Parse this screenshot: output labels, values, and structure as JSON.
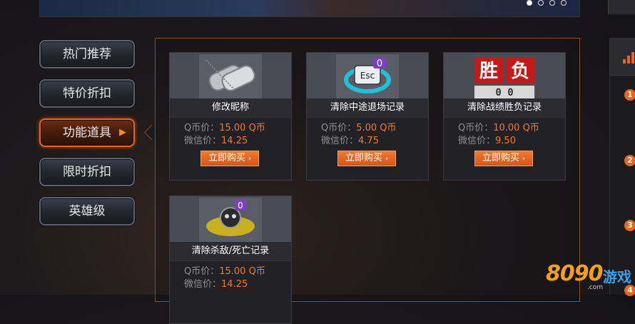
{
  "banner": {
    "dots": 4,
    "active_dot": 1
  },
  "nav": {
    "items": [
      {
        "label": "热门推荐",
        "active": false
      },
      {
        "label": "特价折扣",
        "active": false
      },
      {
        "label": "功能道具",
        "active": true
      },
      {
        "label": "限时折扣",
        "active": false
      },
      {
        "label": "英雄级",
        "active": false
      }
    ]
  },
  "price_labels": {
    "qb": "Q币价：",
    "wx": "微信价："
  },
  "buy_label": "立即购买",
  "products": [
    {
      "name": "修改昵称",
      "qb_price": "15.00 Q币",
      "wx_price": "14.25",
      "icon": "dog-tags-icon"
    },
    {
      "name": "清除中途退场记录",
      "qb_price": "5.00 Q币",
      "wx_price": "4.75",
      "icon": "esc-key-icon",
      "icon_text": "Esc",
      "icon_badge": "0"
    },
    {
      "name": "清除战绩胜负记录",
      "qb_price": "10.00 Q币",
      "wx_price": "9.50",
      "icon": "win-loss-board-icon",
      "icon_text_left": "胜",
      "icon_text_right": "负",
      "icon_score": "0 0"
    },
    {
      "name": "清除杀敌/死亡记录",
      "qb_price": "15.00 Q币",
      "wx_price": "14.25",
      "icon": "skull-reset-icon",
      "icon_badge": "0"
    }
  ],
  "sidebar_right": {
    "ranks": [
      "1",
      "2",
      "3",
      "4"
    ]
  },
  "logo": {
    "number": "8090",
    "text": "游戏",
    "domain": ".com"
  },
  "colors": {
    "accent": "#e8661b",
    "price": "#f07a2a",
    "border": "#8c4a22"
  }
}
